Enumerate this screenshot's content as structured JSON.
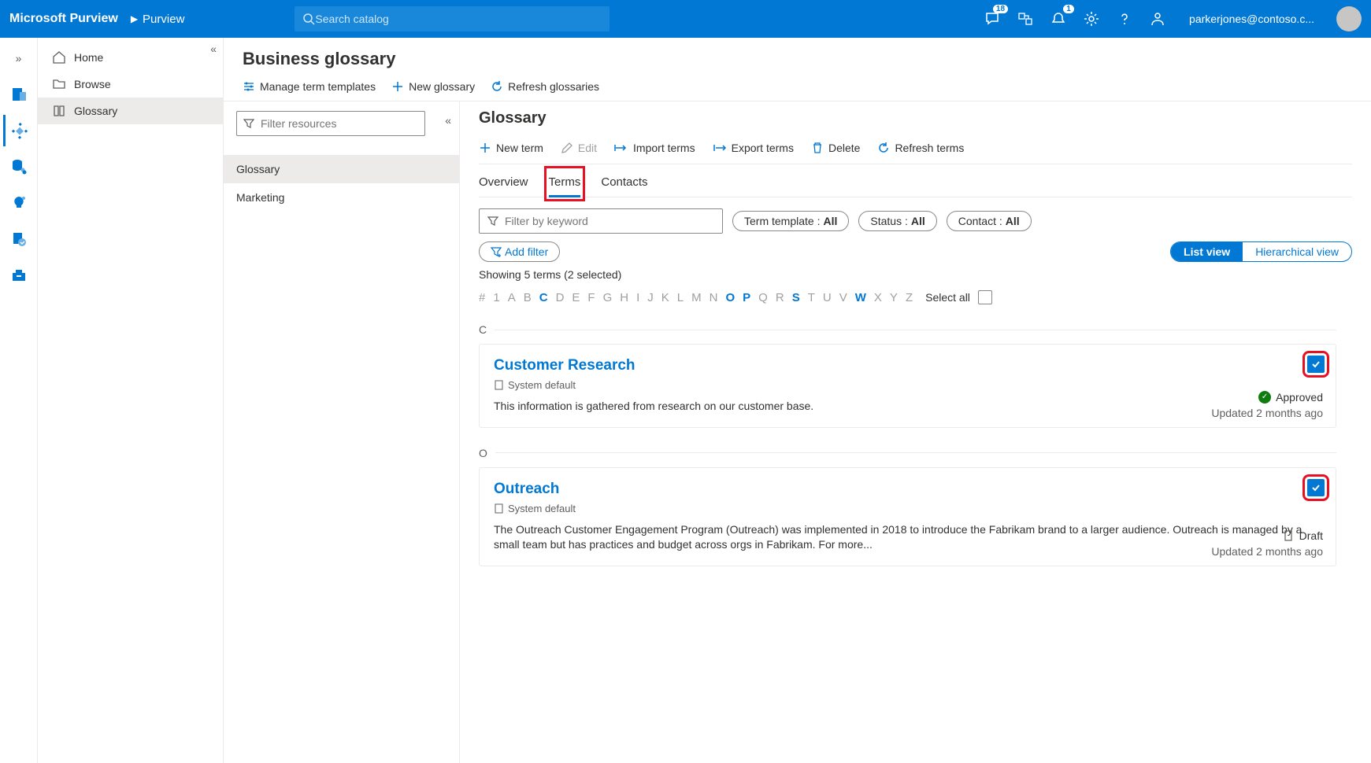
{
  "header": {
    "brand": "Microsoft Purview",
    "crumb": "Purview",
    "search_placeholder": "Search catalog",
    "feedback_badge": "18",
    "notification_badge": "1",
    "user_email": "parkerjones@contoso.c..."
  },
  "nav": {
    "items": [
      "Home",
      "Browse",
      "Glossary"
    ],
    "active": 2
  },
  "page": {
    "title": "Business glossary",
    "commands": {
      "manage_templates": "Manage term templates",
      "new_glossary": "New glossary",
      "refresh": "Refresh glossaries"
    }
  },
  "resources": {
    "filter_placeholder": "Filter resources",
    "items": [
      "Glossary",
      "Marketing"
    ],
    "active": 0
  },
  "detail": {
    "title": "Glossary",
    "commands": {
      "new_term": "New term",
      "edit": "Edit",
      "import": "Import terms",
      "export": "Export terms",
      "delete": "Delete",
      "refresh": "Refresh terms"
    },
    "tabs": [
      "Overview",
      "Terms",
      "Contacts"
    ],
    "active_tab": 1,
    "keyword_placeholder": "Filter by keyword",
    "filters": {
      "template": {
        "label": "Term template :",
        "value": "All"
      },
      "status": {
        "label": "Status :",
        "value": "All"
      },
      "contact": {
        "label": "Contact :",
        "value": "All"
      },
      "add": "Add filter"
    },
    "views": {
      "list": "List view",
      "hier": "Hierarchical view"
    },
    "showing": "Showing 5 terms (2 selected)",
    "alphabet": [
      "#",
      "1",
      "A",
      "B",
      "C",
      "D",
      "E",
      "F",
      "G",
      "H",
      "I",
      "J",
      "K",
      "L",
      "M",
      "N",
      "O",
      "P",
      "Q",
      "R",
      "S",
      "T",
      "U",
      "V",
      "W",
      "X",
      "Y",
      "Z"
    ],
    "alphabet_active": [
      "C",
      "O",
      "P",
      "S",
      "W"
    ],
    "select_all": "Select all"
  },
  "terms": [
    {
      "group": "C",
      "title": "Customer Research",
      "template": "System default",
      "desc": "This information is gathered from research on our customer base.",
      "status": "Approved",
      "status_kind": "approved",
      "updated": "Updated 2 months ago",
      "checked": true
    },
    {
      "group": "O",
      "title": "Outreach",
      "template": "System default",
      "desc": "The Outreach Customer Engagement Program (Outreach) was implemented in 2018 to introduce the Fabrikam brand to a larger audience. Outreach is managed by a small team but has practices and budget across orgs in Fabrikam. For more...",
      "status": "Draft",
      "status_kind": "draft",
      "updated": "Updated 2 months ago",
      "checked": true
    }
  ]
}
